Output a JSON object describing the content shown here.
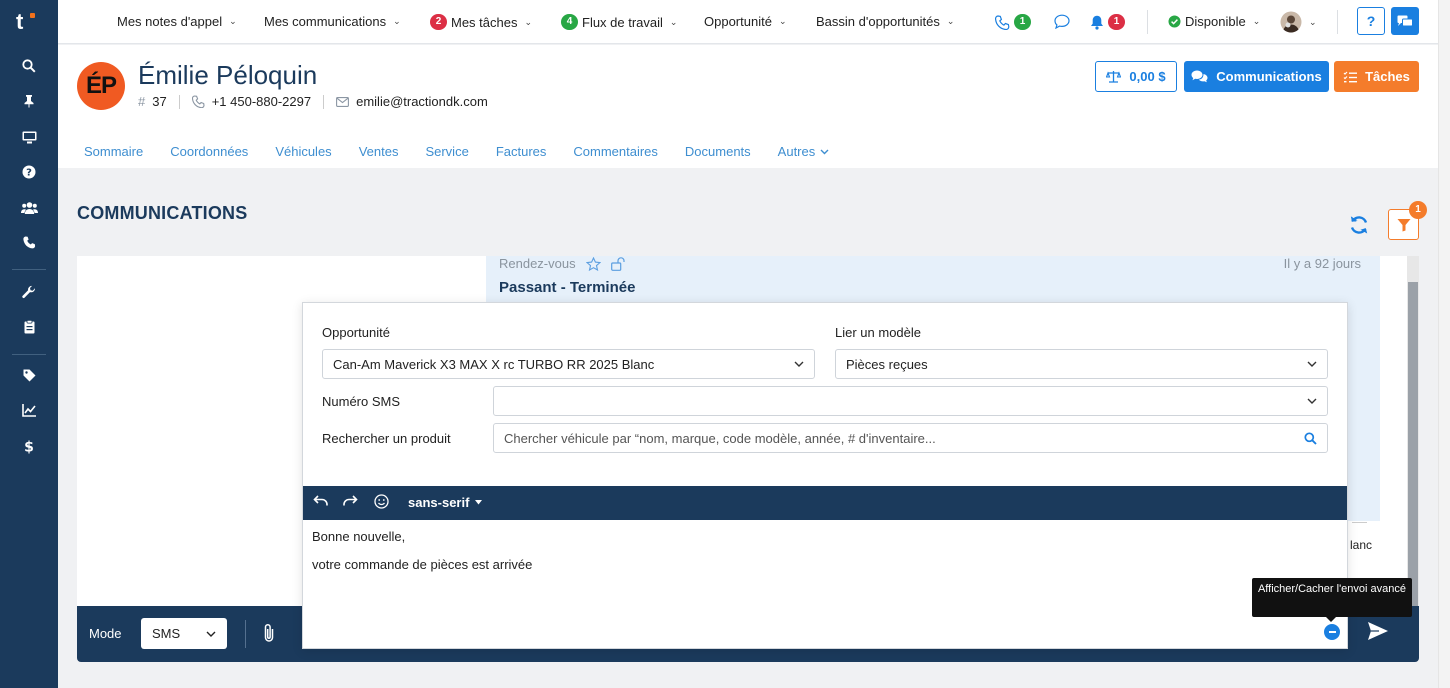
{
  "app": {
    "logo_text": "t"
  },
  "sidebar": {
    "items": [
      {
        "icon": "search-icon"
      },
      {
        "icon": "pin-icon"
      },
      {
        "icon": "monitor-icon"
      },
      {
        "icon": "help-circle-icon"
      },
      {
        "icon": "users-icon"
      },
      {
        "icon": "phone-icon"
      },
      {
        "icon": "wrench-icon"
      },
      {
        "icon": "clipboard-icon"
      },
      {
        "icon": "tag-icon"
      },
      {
        "icon": "chart-line-icon"
      },
      {
        "icon": "dollar-icon"
      }
    ]
  },
  "topnav": {
    "items": [
      {
        "label": "Mes notes d'appel"
      },
      {
        "label": "Mes communications"
      },
      {
        "label": "Mes tâches",
        "badge": "2"
      },
      {
        "label": "Flux de travail",
        "badge": "4"
      },
      {
        "label": "Opportunité"
      },
      {
        "label": "Bassin d'opportunités"
      }
    ],
    "phone_badge": "1",
    "bell_badge": "1",
    "status_label": "Disponible",
    "help_label": "?",
    "colors": {
      "red": "#dc2f45",
      "green": "#28a745",
      "primary": "#1a7fe0"
    }
  },
  "contact": {
    "initials": "ÉP",
    "name": "Émilie Péloquin",
    "number_symbol": "#",
    "number": "37",
    "phone": "+1 450-880-2297",
    "email": "emilie@tractiondk.com",
    "balance": "0,00 $",
    "communications_label": "Communications",
    "tasks_label": "Tâches"
  },
  "tabs": [
    {
      "label": "Sommaire"
    },
    {
      "label": "Coordonnées"
    },
    {
      "label": "Véhicules"
    },
    {
      "label": "Ventes"
    },
    {
      "label": "Service"
    },
    {
      "label": "Factures"
    },
    {
      "label": "Commentaires"
    },
    {
      "label": "Documents"
    },
    {
      "label": "Autres"
    }
  ],
  "section": {
    "title": "COMMUNICATIONS",
    "filter_badge": "1"
  },
  "message": {
    "type": "Rendez-vous",
    "time": "Il y a 92 jours",
    "title": "Passant - Terminée",
    "fragment": "lanc"
  },
  "form": {
    "opportunity_label": "Opportunité",
    "opportunity_value": "Can-Am Maverick X3 MAX X rc TURBO RR 2025 Blanc",
    "template_label": "Lier un modèle",
    "template_value": "Pièces reçues",
    "sms_label": "Numéro SMS",
    "sms_value": "",
    "product_label": "Rechercher un produit",
    "product_placeholder": "Chercher véhicule par “nom, marque, code modèle, année, # d'inventaire..."
  },
  "editor": {
    "font": "sans-serif",
    "lines": [
      "Bonne nouvelle,",
      "votre commande de pièces est arrivée"
    ]
  },
  "bottom": {
    "mode_label": "Mode",
    "mode_value": "SMS",
    "tooltip": "Afficher/Cacher l'envoi avancé"
  }
}
